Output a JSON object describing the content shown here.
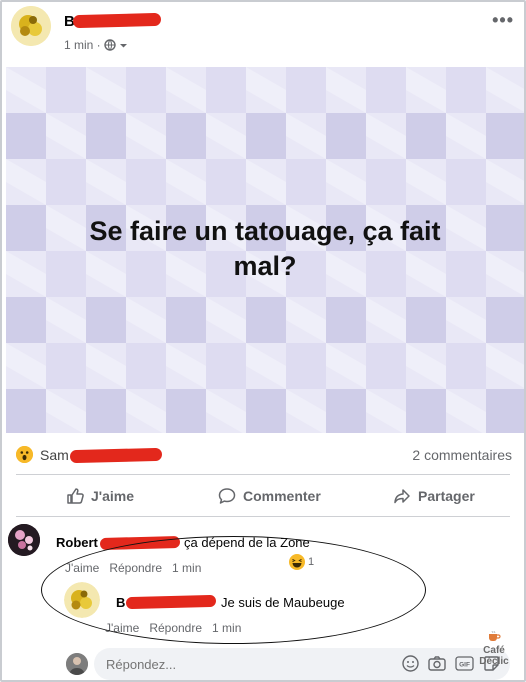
{
  "post": {
    "author": "B",
    "time": "1 min ·",
    "more": "•••",
    "image_text": [
      "Se faire un tatouage, ça fait",
      "mal?"
    ]
  },
  "reactions": {
    "reactor": "Sam",
    "comments_count": "2 commentaires"
  },
  "actions": {
    "like": "J'aime",
    "comment": "Commenter",
    "share": "Partager"
  },
  "comments": [
    {
      "author": "Robert",
      "text": "ça dépend de la Zone",
      "like": "J'aime",
      "reply": "Répondre",
      "time": "1 min",
      "reaction_count": "1"
    },
    {
      "author": "B",
      "text": "Je suis de Maubeuge",
      "like": "J'aime",
      "reply": "Répondre",
      "time": "1 min"
    }
  ],
  "composer": {
    "placeholder": "Répondez..."
  },
  "watermark": [
    "Café",
    "Déclic"
  ],
  "colors": {
    "redaction": "#e3281c",
    "image_bg": "#dcdcef",
    "secondary_text": "#65676b"
  }
}
